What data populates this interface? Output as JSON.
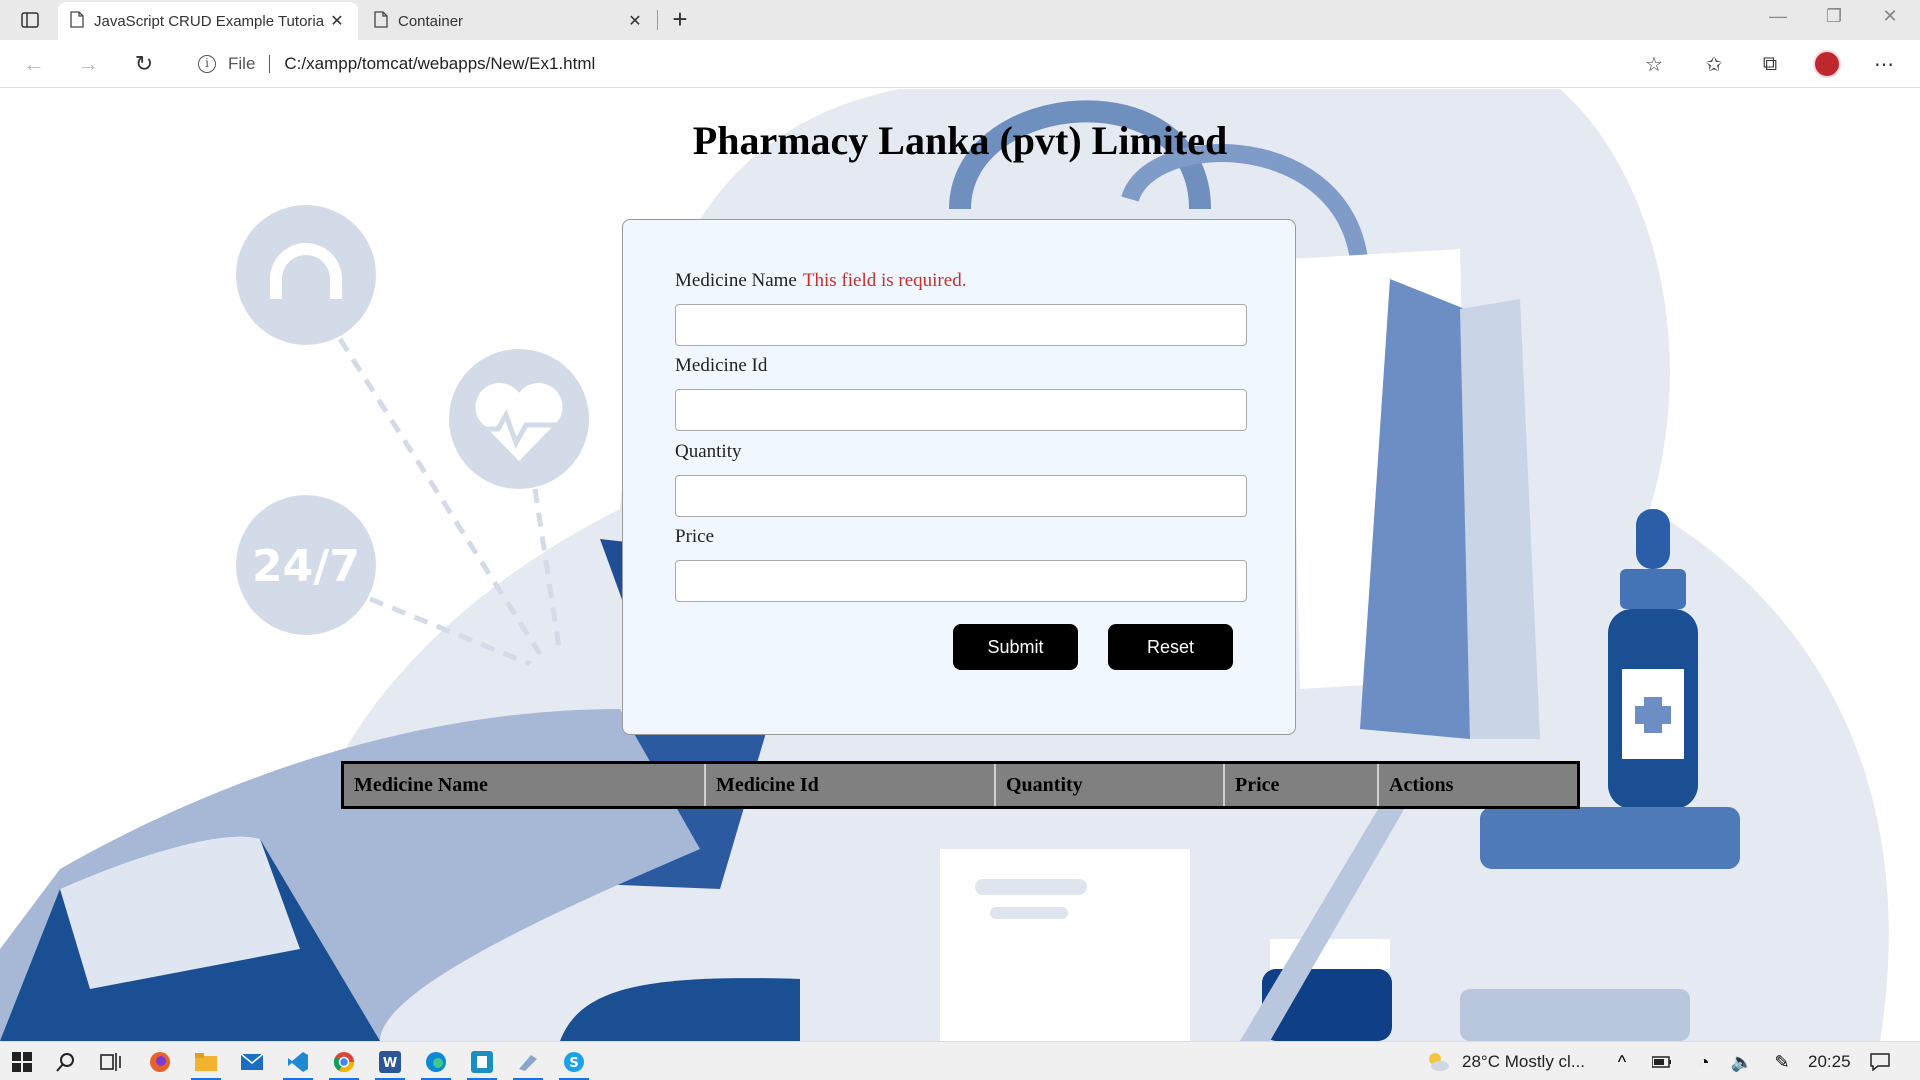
{
  "browser": {
    "tabs": [
      {
        "title": "JavaScript CRUD Example Tutoria",
        "active": true
      },
      {
        "title": "Container",
        "active": false
      }
    ],
    "address": {
      "scheme_label": "File",
      "url": "C:/xampp/tomcat/webapps/New/Ex1.html"
    }
  },
  "page": {
    "title": "Pharmacy Lanka (pvt) Limited",
    "form": {
      "fields": [
        {
          "label": "Medicine Name",
          "error": "This field is required.",
          "value": ""
        },
        {
          "label": "Medicine Id",
          "value": ""
        },
        {
          "label": "Quantity",
          "value": ""
        },
        {
          "label": "Price",
          "value": ""
        }
      ],
      "submit_label": "Submit",
      "reset_label": "Reset"
    },
    "table": {
      "headers": [
        "Medicine Name",
        "Medicine Id",
        "Quantity",
        "Price",
        "Actions"
      ]
    },
    "background_text": "24/7"
  },
  "taskbar": {
    "weather": "28°C  Mostly cl...",
    "time": "20:25"
  },
  "colors": {
    "accent_blue": "#1f4e96",
    "error_red": "#cc2b2b",
    "card_bg": "#f0f7ff",
    "table_header_bg": "#808080"
  }
}
